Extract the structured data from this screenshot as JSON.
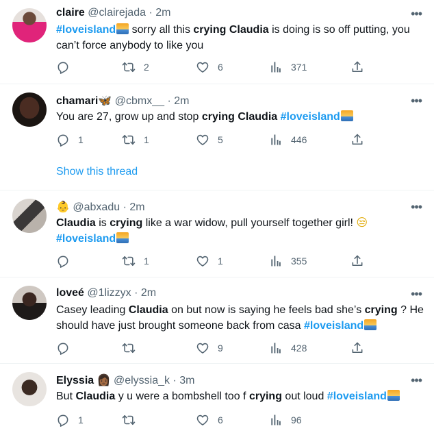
{
  "tweets": [
    {
      "name": "claire",
      "name_emoji": "",
      "handle": "@clairejada",
      "time": "2m",
      "text_parts": [
        "#loveisland",
        " sorry all this ",
        "crying",
        " ",
        "Claudia",
        " is doing is so off putting, you can’t force anybody to like you"
      ],
      "reply_count": "",
      "retweet_count": "2",
      "like_count": "6",
      "view_count": "371"
    },
    {
      "name": "chamari",
      "name_emoji": "🦋",
      "handle": "@cbmx__",
      "time": "2m",
      "text_parts": [
        "You are 27, grow up and stop ",
        "crying",
        " ",
        "Claudia",
        " ",
        "#loveisland"
      ],
      "reply_count": "1",
      "retweet_count": "1",
      "like_count": "5",
      "view_count": "446",
      "show_thread": "Show this thread"
    },
    {
      "name": "",
      "name_emoji": "👶",
      "handle": "@abxadu",
      "time": "2m",
      "text_parts": [
        "Claudia",
        " is ",
        "crying",
        " like a war widow, pull yourself together girl! ",
        "😒",
        "#loveisland"
      ],
      "reply_count": "",
      "retweet_count": "1",
      "like_count": "1",
      "view_count": "355"
    },
    {
      "name": "loveé",
      "name_emoji": "",
      "handle": "@1lizzyx",
      "time": "2m",
      "text_parts": [
        "Casey leading ",
        "Claudia",
        " on but now is saying he feels bad she’s ",
        "crying",
        " ? He should have just brought someone back from casa  ",
        "#loveisland"
      ],
      "reply_count": "",
      "retweet_count": "",
      "like_count": "9",
      "view_count": "428"
    },
    {
      "name": "Elyssia",
      "name_emoji": "👩🏾",
      "handle": "@elyssia_k",
      "time": "3m",
      "text_parts": [
        "But ",
        "Claudia",
        " y",
        "u were a bombshell too f",
        "crying",
        " out loud ",
        "#loveisland"
      ],
      "reply_count": "1",
      "retweet_count": "",
      "like_count": "6",
      "view_count": "96"
    }
  ],
  "dot_separator": "·",
  "more_label": "•••",
  "colors": {
    "link": "#1d9bf0",
    "muted": "#536471",
    "text": "#0f1419",
    "divider": "#eff3f4"
  },
  "icons": [
    "reply-icon",
    "retweet-icon",
    "like-icon",
    "views-icon",
    "share-icon",
    "more-icon",
    "sunset-emoji-icon"
  ]
}
